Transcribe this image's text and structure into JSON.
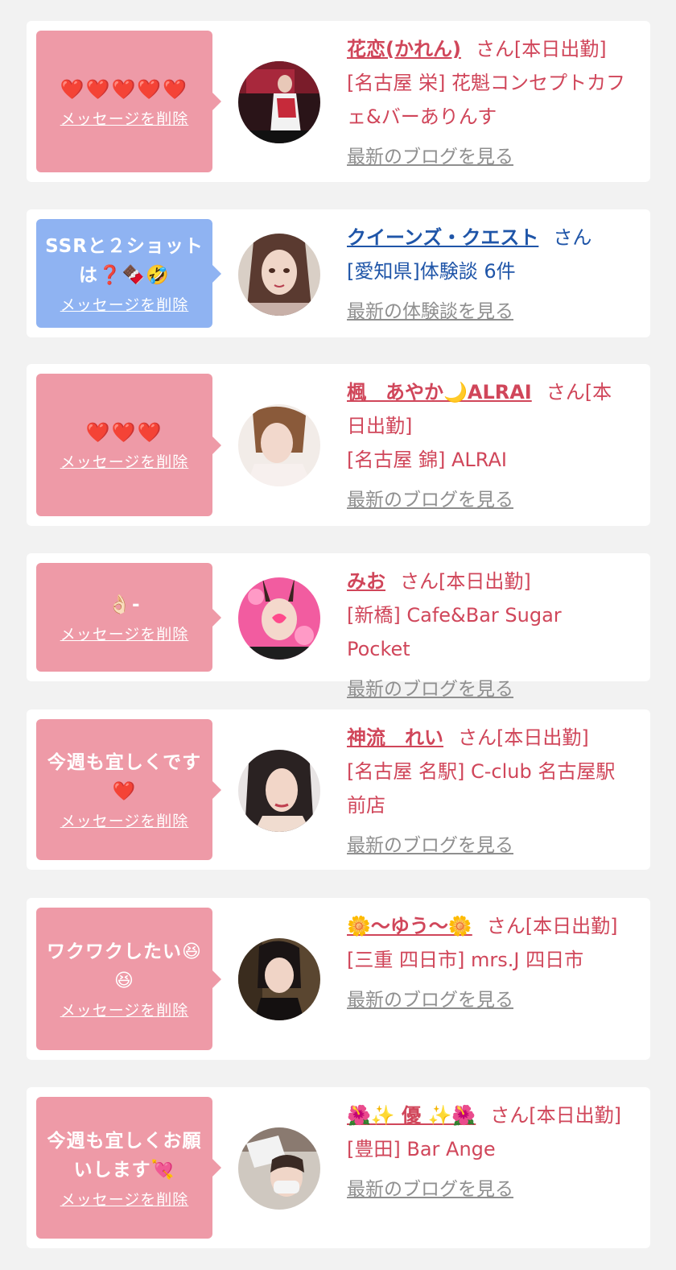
{
  "cards": [
    {
      "message": "❤️❤️❤️❤️❤️",
      "delete_label": "メッセージを削除",
      "name": "花恋(かれん)",
      "suffix": "さん[本日出勤]",
      "shop": "[名古屋 栄] 花魁コンセプトカフェ&バーありんす",
      "link": "最新のブログを見る",
      "theme": "pink"
    },
    {
      "message": "SSRと２ショットは❓🍫🤣",
      "delete_label": "メッセージを削除",
      "name": "クイーンズ・クエスト",
      "suffix": "さん",
      "shop": "[愛知県]体験談 6件",
      "link": "最新の体験談を見る",
      "theme": "blue"
    },
    {
      "message": "❤️❤️❤️",
      "delete_label": "メッセージを削除",
      "name": "楓　あやか🌙ALRAI",
      "suffix": "さん[本日出勤]",
      "shop": "[名古屋 錦] ALRAI",
      "link": "最新のブログを見る",
      "theme": "pink"
    },
    {
      "message": "👌🏻-",
      "delete_label": "メッセージを削除",
      "name": "みお",
      "suffix": "さん[本日出勤]",
      "shop": "[新橋] Cafe&Bar Sugar Pocket",
      "link": "最新のブログを見る",
      "theme": "pink"
    },
    {
      "message": "今週も宜しくです❤️",
      "delete_label": "メッセージを削除",
      "name": "神流　れい",
      "suffix": "さん[本日出勤]",
      "shop": "[名古屋 名駅] C-club 名古屋駅前店",
      "link": "最新のブログを見る",
      "theme": "pink"
    },
    {
      "message": "ワクワクしたい😆😆",
      "delete_label": "メッセージを削除",
      "name": "🌼〜ゆう〜🌼",
      "suffix": "さん[本日出勤]",
      "shop": "[三重 四日市] mrs.J 四日市",
      "link": "最新のブログを見る",
      "theme": "pink"
    },
    {
      "message": "今週も宜しくお願いします💘",
      "delete_label": "メッセージを削除",
      "name": "🌺✨ 優 ✨🌺",
      "suffix": "さん[本日出勤]",
      "shop": "[豊田] Bar Ange",
      "link": "最新のブログを見る",
      "theme": "pink"
    }
  ]
}
